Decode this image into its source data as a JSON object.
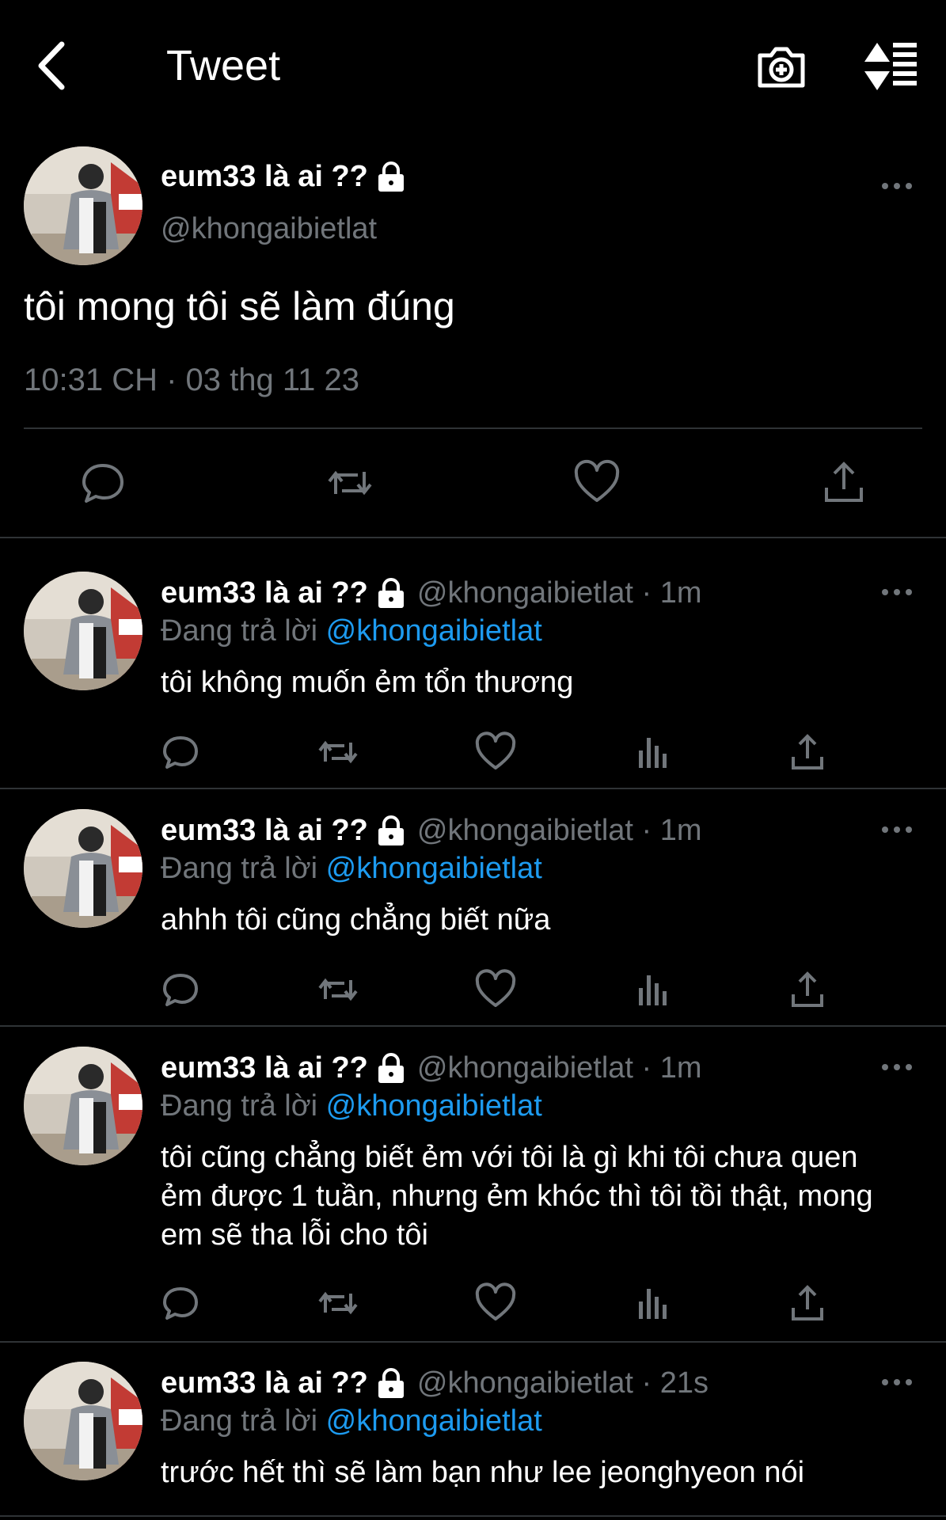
{
  "header": {
    "title": "Tweet"
  },
  "main_tweet": {
    "display_name": "eum33 là ai ??",
    "handle": "@khongaibietlat",
    "text": "tôi mong tôi sẽ làm đúng",
    "timestamp": "10:31 CH · 03 thg 11 23"
  },
  "replies": [
    {
      "display_name": "eum33 là ai ??",
      "meta": "@khongaibietlat · 1m",
      "replying_prefix": "Đang trả lời",
      "replying_to": "@khongaibietlat",
      "text": "tôi không muốn ẻm tổn thương"
    },
    {
      "display_name": "eum33 là ai ??",
      "meta": "@khongaibietlat · 1m",
      "replying_prefix": "Đang trả lời",
      "replying_to": "@khongaibietlat",
      "text": "ahhh tôi cũng chẳng biết nữa"
    },
    {
      "display_name": "eum33 là ai ??",
      "meta": "@khongaibietlat · 1m",
      "replying_prefix": "Đang trả lời",
      "replying_to": "@khongaibietlat",
      "text": "tôi cũng chẳng biết ẻm với tôi là gì khi tôi chưa quen ẻm được 1 tuần, nhưng ẻm khóc thì tôi tồi thật, mong em sẽ tha lỗi cho tôi"
    },
    {
      "display_name": "eum33 là ai ??",
      "meta": "@khongaibietlat · 21s",
      "replying_prefix": "Đang trả lời",
      "replying_to": "@khongaibietlat",
      "text": "trước hết thì sẽ làm bạn như lee jeonghyeon nói"
    }
  ],
  "colors": {
    "background": "#000000",
    "text": "#e7e9ea",
    "muted": "#71767b",
    "accent": "#1d9bf0",
    "divider": "#2f3336"
  },
  "icons": [
    "back-arrow-icon",
    "camera-plus-icon",
    "sort-icon",
    "lock-icon",
    "more-icon",
    "reply-icon",
    "retweet-icon",
    "like-icon",
    "share-icon",
    "views-icon"
  ]
}
